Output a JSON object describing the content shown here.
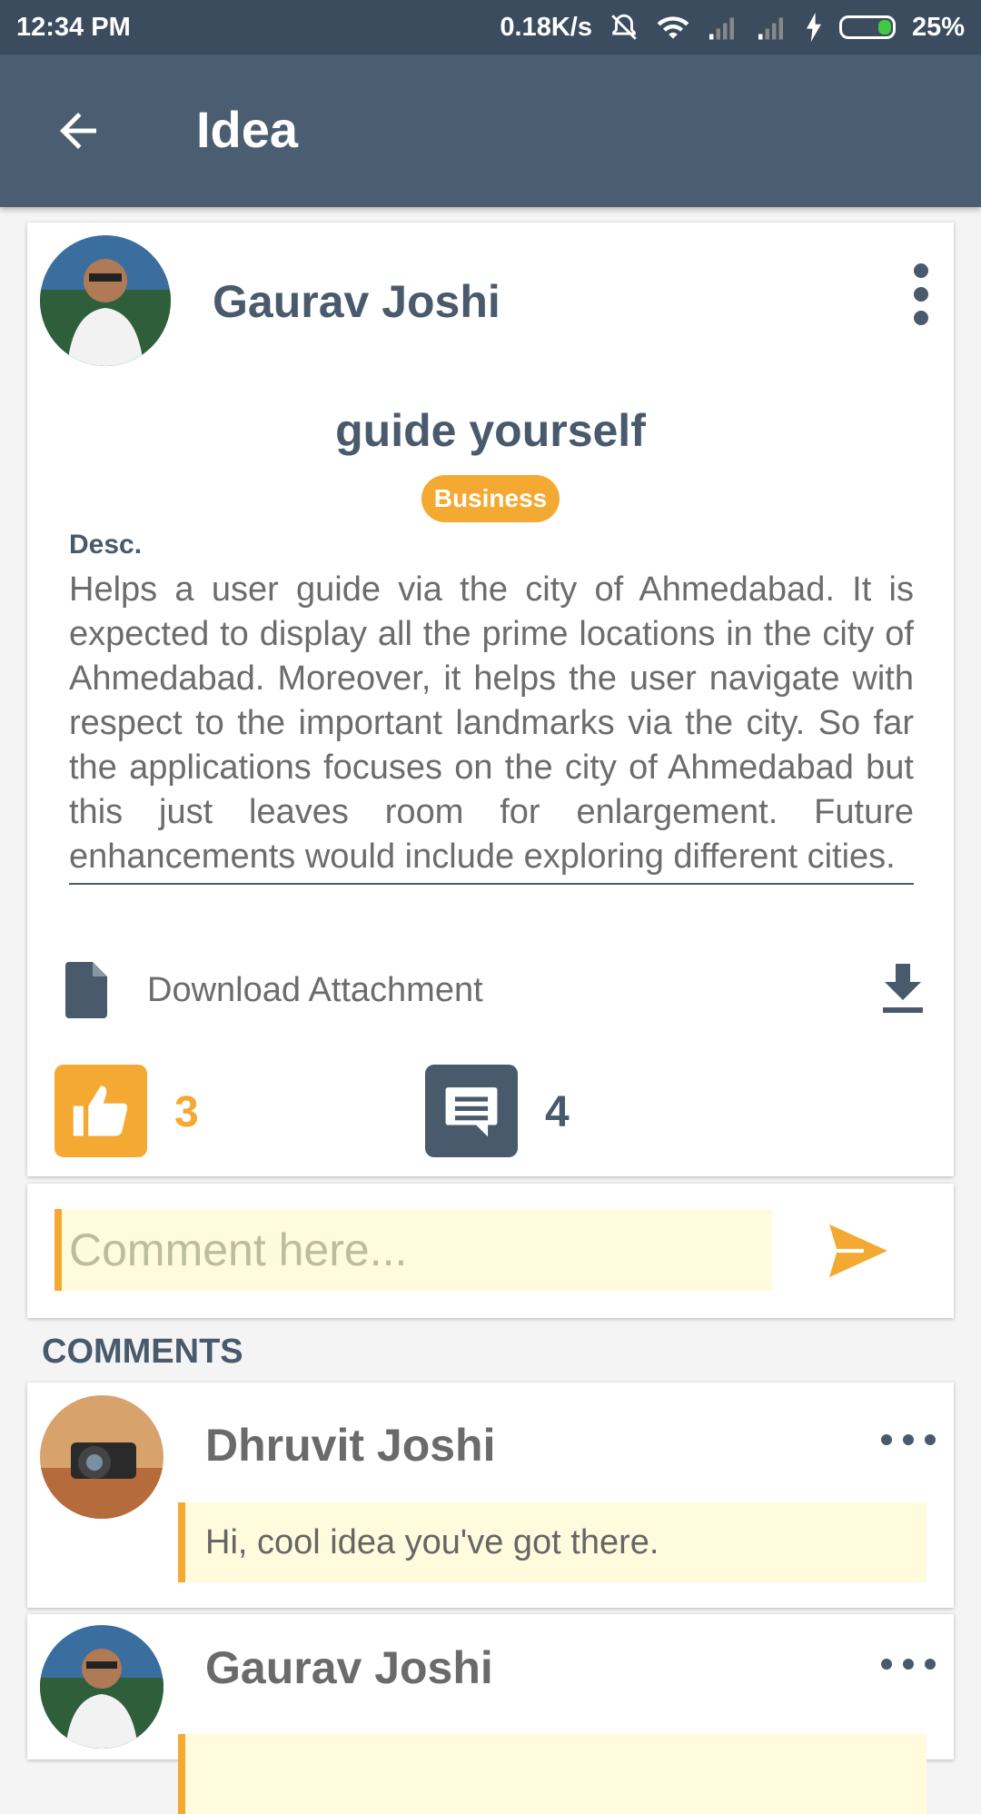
{
  "status_bar": {
    "time": "12:34 PM",
    "network_speed": "0.18K/s",
    "battery_percent": "25%",
    "icons": [
      "mute-icon",
      "wifi-icon",
      "signal-icon",
      "signal-icon",
      "charging-icon",
      "battery-icon"
    ]
  },
  "app_bar": {
    "title": "Idea",
    "back_icon": "arrow-left-icon"
  },
  "post": {
    "author": "Gaurav Joshi",
    "title": "guide yourself",
    "category": "Business",
    "desc_label": "Desc.",
    "description": "Helps a user guide via the city of Ahmedabad. It is expected to display all the prime locations in the city of Ahmedabad. Moreover, it helps the user navigate with respect to the important landmarks via the city. So far the applications focuses on the city of Ahmedabad but this just leaves room for enlargement. Future enhancements would include exploring different cities.",
    "attachment_label": "Download Attachment",
    "likes": "3",
    "comments": "4"
  },
  "composer": {
    "placeholder": "Comment here...",
    "value": ""
  },
  "comments_heading": "COMMENTS",
  "comments": [
    {
      "author": "Dhruvit Joshi",
      "text": "Hi, cool idea you've got there."
    },
    {
      "author": "Gaurav Joshi",
      "text": ""
    }
  ],
  "colors": {
    "primary": "#4a5d71",
    "status_bar": "#3a4c5e",
    "accent": "#f4a933",
    "text_dark": "#485a6c",
    "comment_bg": "#fffbdc"
  }
}
